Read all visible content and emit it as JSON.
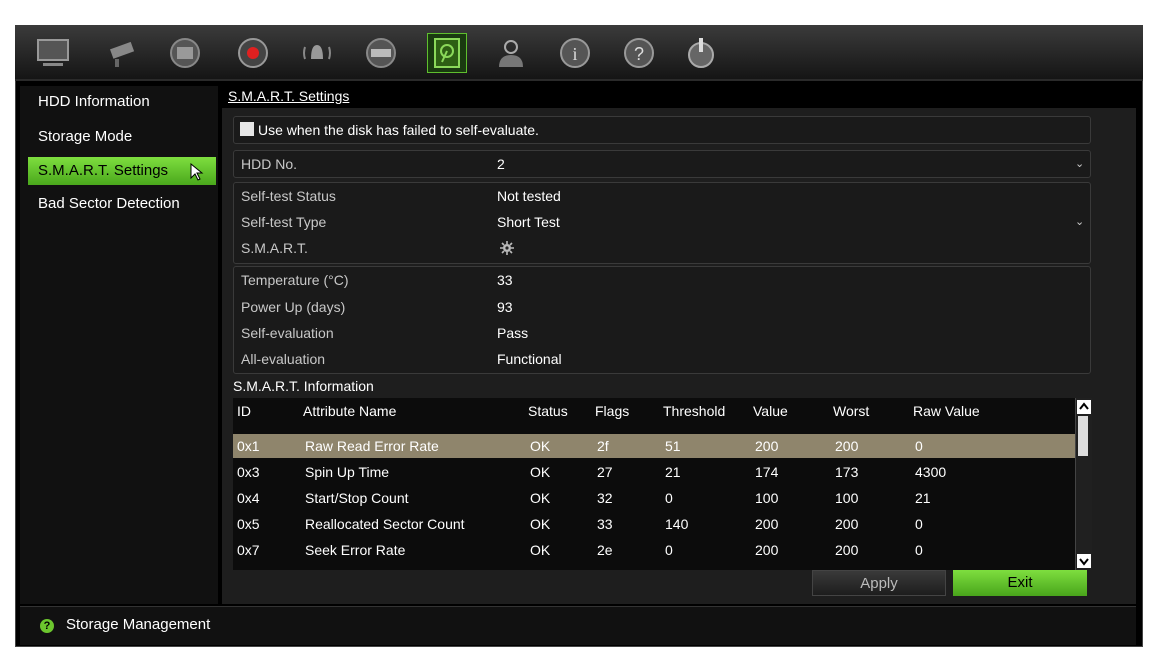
{
  "toolbar": {
    "icons": [
      "monitor-icon",
      "camera-icon",
      "network-icon",
      "record-icon",
      "alarm-icon",
      "device-icon",
      "storage-icon",
      "user-icon",
      "info-icon",
      "help-icon",
      "power-icon"
    ]
  },
  "sidebar": {
    "items": [
      {
        "label": "HDD Information"
      },
      {
        "label": "Storage Mode"
      },
      {
        "label": "S.M.A.R.T. Settings"
      },
      {
        "label": "Bad Sector Detection"
      }
    ]
  },
  "main": {
    "title": "S.M.A.R.T. Settings",
    "checkbox_label": "Use when the disk has failed to self-evaluate.",
    "hdd_no": {
      "label": "HDD No.",
      "value": "2"
    },
    "self_test_status": {
      "label": "Self-test Status",
      "value": "Not tested"
    },
    "self_test_type": {
      "label": "Self-test Type",
      "value": "Short Test"
    },
    "smart": {
      "label": "S.M.A.R.T."
    },
    "temperature": {
      "label": "Temperature (°C)",
      "value": "33"
    },
    "power_up": {
      "label": "Power Up (days)",
      "value": "93"
    },
    "self_evaluation": {
      "label": "Self-evaluation",
      "value": "Pass"
    },
    "all_evaluation": {
      "label": "All-evaluation",
      "value": "Functional"
    },
    "info_title": "S.M.A.R.T. Information"
  },
  "table": {
    "headers": [
      "ID",
      "Attribute Name",
      "Status",
      "Flags",
      "Threshold",
      "Value",
      "Worst",
      "Raw Value"
    ],
    "rows": [
      [
        "0x1",
        "Raw Read Error Rate",
        "OK",
        "2f",
        "51",
        "200",
        "200",
        "0"
      ],
      [
        "0x3",
        "Spin Up Time",
        "OK",
        "27",
        "21",
        "174",
        "173",
        "4300"
      ],
      [
        "0x4",
        "Start/Stop Count",
        "OK",
        "32",
        "0",
        "100",
        "100",
        "21"
      ],
      [
        "0x5",
        "Reallocated Sector Count",
        "OK",
        "33",
        "140",
        "200",
        "200",
        "0"
      ],
      [
        "0x7",
        "Seek Error Rate",
        "OK",
        "2e",
        "0",
        "200",
        "200",
        "0"
      ]
    ]
  },
  "buttons": {
    "apply": "Apply",
    "exit": "Exit"
  },
  "status_bar": {
    "text": "Storage Management"
  },
  "colors": {
    "accent": "#5fbf2e",
    "selected_row": "#8f856c"
  }
}
